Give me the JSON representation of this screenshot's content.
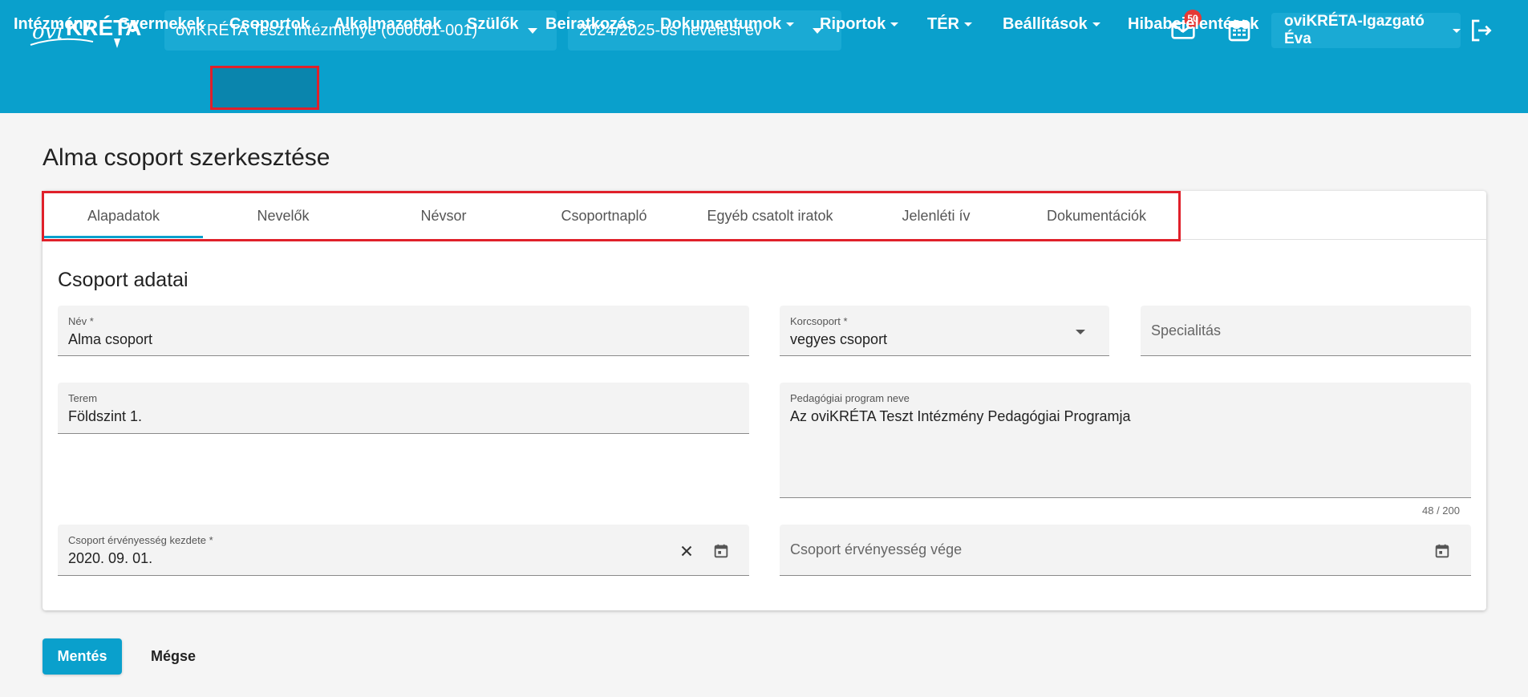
{
  "header": {
    "logo_text": "oviKRÉTA",
    "institution_select": "oviKRÉTA Teszt Intézménye (000001-001)",
    "year_select": "2024/2025-ös nevelési év",
    "mail_badge": "50",
    "user_name": "oviKRÉTA-Igazgató Éva",
    "icons": [
      "mail-icon",
      "calendar-icon",
      "logout-icon"
    ]
  },
  "nav": {
    "items": [
      {
        "label": "Intézmény"
      },
      {
        "label": "Gyermekek"
      },
      {
        "label": "Csoportok",
        "active": true
      },
      {
        "label": "Alkalmazottak"
      },
      {
        "label": "Szülők"
      },
      {
        "label": "Beiratkozás"
      },
      {
        "label": "Dokumentumok",
        "dropdown": true
      },
      {
        "label": "Riportok",
        "dropdown": true
      },
      {
        "label": "TÉR",
        "dropdown": true
      },
      {
        "label": "Beállítások",
        "dropdown": true
      },
      {
        "label": "Hibabejelentések"
      }
    ]
  },
  "page": {
    "title": "Alma csoport szerkesztése"
  },
  "tabs": [
    {
      "label": "Alapadatok",
      "active": true
    },
    {
      "label": "Nevelők"
    },
    {
      "label": "Névsor"
    },
    {
      "label": "Csoportnapló"
    },
    {
      "label": "Egyéb csatolt iratok"
    },
    {
      "label": "Jelenléti ív"
    },
    {
      "label": "Dokumentációk"
    }
  ],
  "form": {
    "section_title": "Csoport adatai",
    "name": {
      "label": "Név *",
      "value": "Alma csoport"
    },
    "age_group": {
      "label": "Korcsoport *",
      "value": "vegyes csoport"
    },
    "speciality": {
      "placeholder": "Specialitás"
    },
    "room": {
      "label": "Terem",
      "value": "Földszint 1."
    },
    "program": {
      "label": "Pedagógiai program neve",
      "value": "Az oviKRÉTA Teszt Intézmény Pedagógiai Programja",
      "counter": "48 / 200"
    },
    "valid_from": {
      "label": "Csoport érvényesség kezdete *",
      "value": "2020. 09. 01."
    },
    "valid_to": {
      "placeholder": "Csoport érvényesség vége"
    }
  },
  "actions": {
    "save_label": "Mentés",
    "cancel_label": "Mégse"
  },
  "colors": {
    "brand": "#0aa0cc",
    "highlight": "#e0202a",
    "badge": "#e53935"
  }
}
